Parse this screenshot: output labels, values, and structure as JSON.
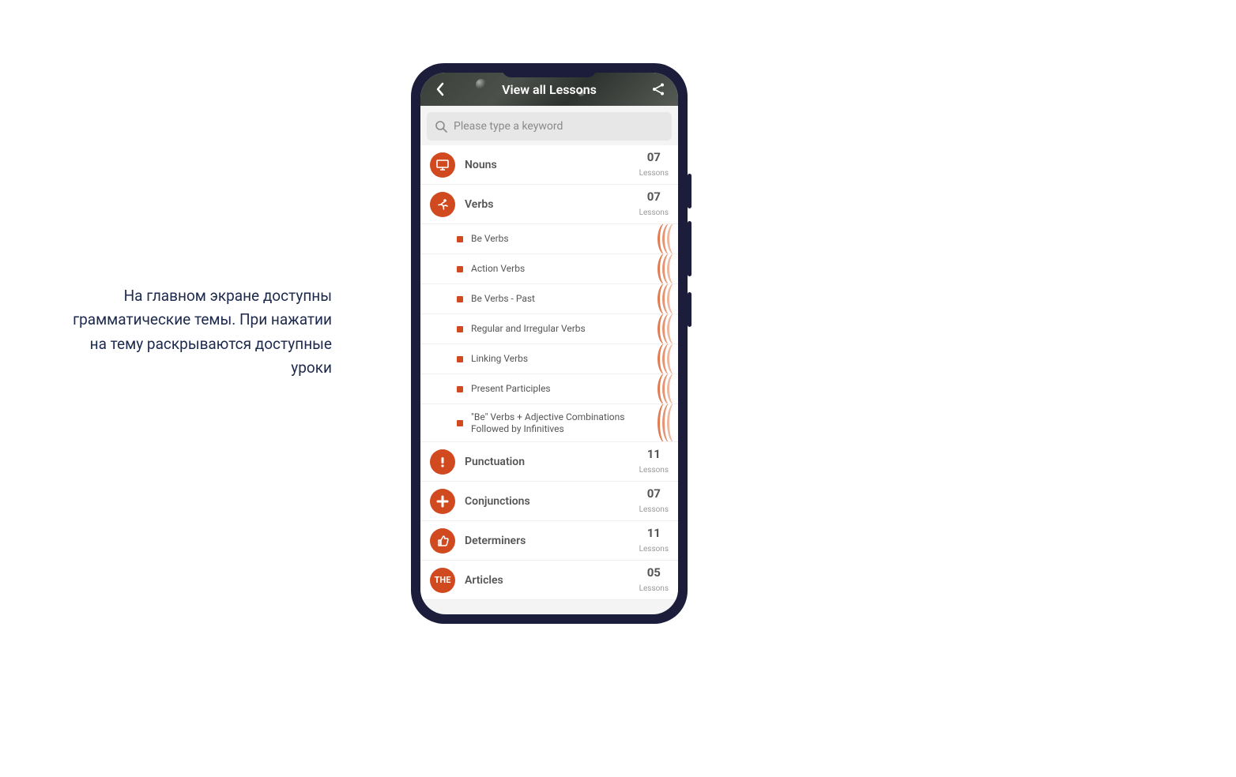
{
  "caption": "На главном экране доступны грамматические темы. При нажатии на тему раскрываются доступные уроки",
  "header": {
    "title": "View all Lessons"
  },
  "search": {
    "placeholder": "Please type a keyword"
  },
  "lessons_label": "Lessons",
  "categories": [
    {
      "icon": "monitor",
      "label": "Nouns",
      "count": "07"
    },
    {
      "icon": "run",
      "label": "Verbs",
      "count": "07"
    },
    {
      "icon": "exclaim",
      "label": "Punctuation",
      "count": "11"
    },
    {
      "icon": "plus",
      "label": "Conjunctions",
      "count": "07"
    },
    {
      "icon": "thumb",
      "label": "Determiners",
      "count": "11"
    },
    {
      "icon": "the",
      "label": "Articles",
      "count": "05"
    }
  ],
  "verbs_sublessons": [
    "Be Verbs",
    "Action Verbs",
    "Be Verbs - Past",
    "Regular and Irregular Verbs",
    "Linking Verbs",
    "Present Participles",
    "\"Be\" Verbs + Adjective Combinations Followed by Infinitives"
  ]
}
